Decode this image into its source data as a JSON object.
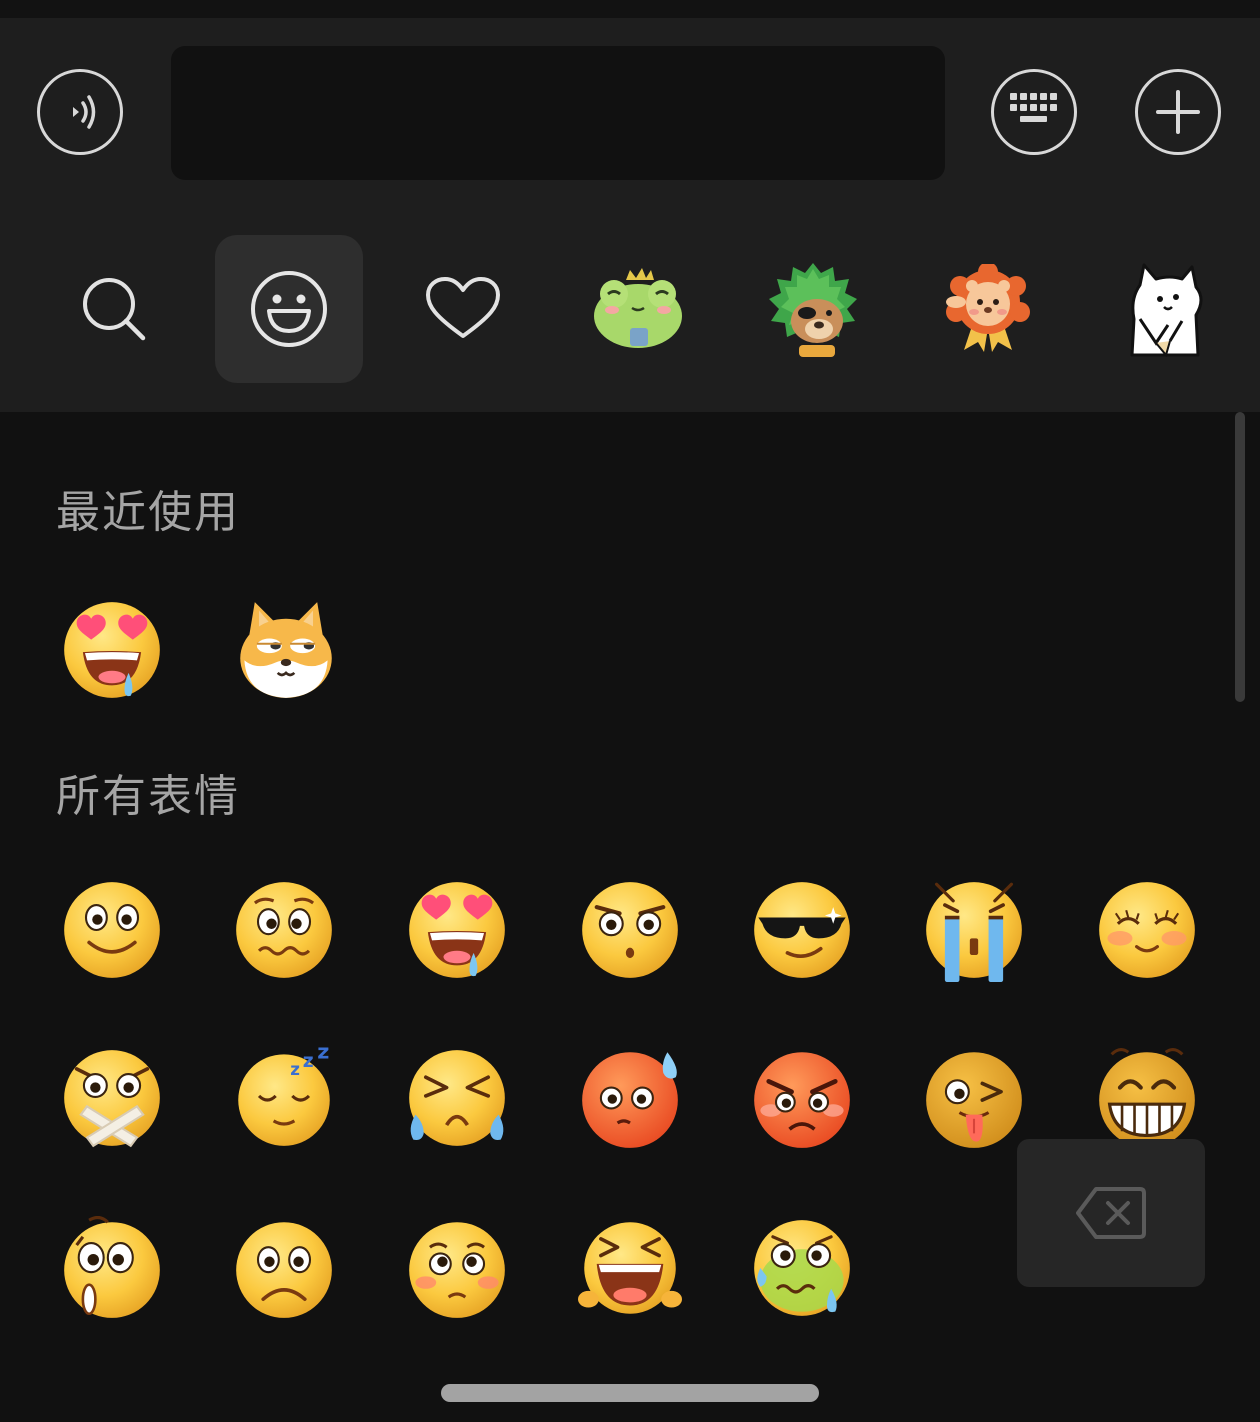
{
  "input_bar": {
    "voice_icon": "voice-wave-icon",
    "message_text": "",
    "keyboard_icon": "keyboard-icon",
    "plus_icon": "plus-icon"
  },
  "tabs": [
    {
      "icon": "search-icon",
      "active": false
    },
    {
      "icon": "smiley-icon",
      "active": true
    },
    {
      "icon": "heart-icon",
      "active": false
    },
    {
      "icon": "frog-sticker-pack-icon",
      "active": false
    },
    {
      "icon": "green-lion-sticker-pack-icon",
      "active": false
    },
    {
      "icon": "lion-badge-sticker-pack-icon",
      "active": false
    },
    {
      "icon": "white-cat-sticker-pack-icon",
      "active": false
    }
  ],
  "recent": {
    "title": "最近使用",
    "items": [
      "heart-eyes-drool-emoji",
      "doge-cat-emoji"
    ]
  },
  "all": {
    "title": "所有表情",
    "items": [
      "smile-emoji",
      "wavy-mouth-emoji",
      "heart-eyes-drool-emoji",
      "stunned-emoji",
      "sunglasses-emoji",
      "crying-emoji",
      "shy-emoji",
      "shut-mouth-emoji",
      "sleepy-emoji",
      "sob-emoji",
      "embarrassed-emoji",
      "angry-emoji",
      "wink-tongue-emoji",
      "grin-emoji",
      "shocked-emoji",
      "sad-emoji",
      "blush-emoji",
      "laugh-cry-emoji",
      "nauseous-emoji"
    ]
  },
  "delete_icon": "backspace-icon",
  "colors": {
    "background": "#111111",
    "bar": "#1e1e1e",
    "active_tab": "#2e2e2e",
    "emoji_yellow": "#f9c83a",
    "heart_pink": "#ff4f79"
  }
}
